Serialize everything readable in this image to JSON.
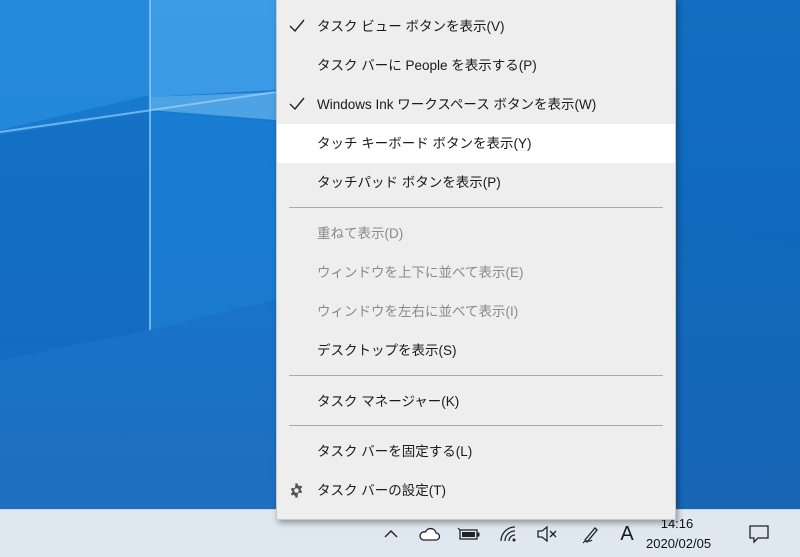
{
  "context_menu": {
    "items": [
      {
        "label": "タスク ビュー ボタンを表示(V)",
        "checked": true
      },
      {
        "label": "タスク バーに People を表示する(P)",
        "checked": false
      },
      {
        "label": "Windows Ink ワークスペース ボタンを表示(W)",
        "checked": true
      },
      {
        "label": "タッチ キーボード ボタンを表示(Y)",
        "checked": false,
        "highlighted": true
      },
      {
        "label": "タッチパッド ボタンを表示(P)",
        "checked": false
      },
      {
        "label": "重ねて表示(D)",
        "disabled": true
      },
      {
        "label": "ウィンドウを上下に並べて表示(E)",
        "disabled": true
      },
      {
        "label": "ウィンドウを左右に並べて表示(I)",
        "disabled": true
      },
      {
        "label": "デスクトップを表示(S)"
      },
      {
        "label": "タスク マネージャー(K)"
      },
      {
        "label": "タスク バーを固定する(L)"
      },
      {
        "label": "タスク バーの設定(T)",
        "icon": "gear-icon"
      }
    ]
  },
  "taskbar": {
    "tray_icons": [
      "chevron-up-icon",
      "onedrive-cloud-icon",
      "battery-icon",
      "wifi-icon",
      "speaker-muted-icon",
      "pen-workspace-icon",
      "ime-mode-icon"
    ],
    "ime_mode_label": "A",
    "clock": {
      "time": "14:16",
      "date": "2020/02/05"
    },
    "notification_icon": "action-center-icon"
  },
  "colors": {
    "wallpaper": "#1676cb",
    "menu_background": "#eeeeee",
    "menu_highlight": "#ffffff",
    "taskbar_background": "#dfe8f1",
    "disabled_text": "#8a8a8a"
  }
}
